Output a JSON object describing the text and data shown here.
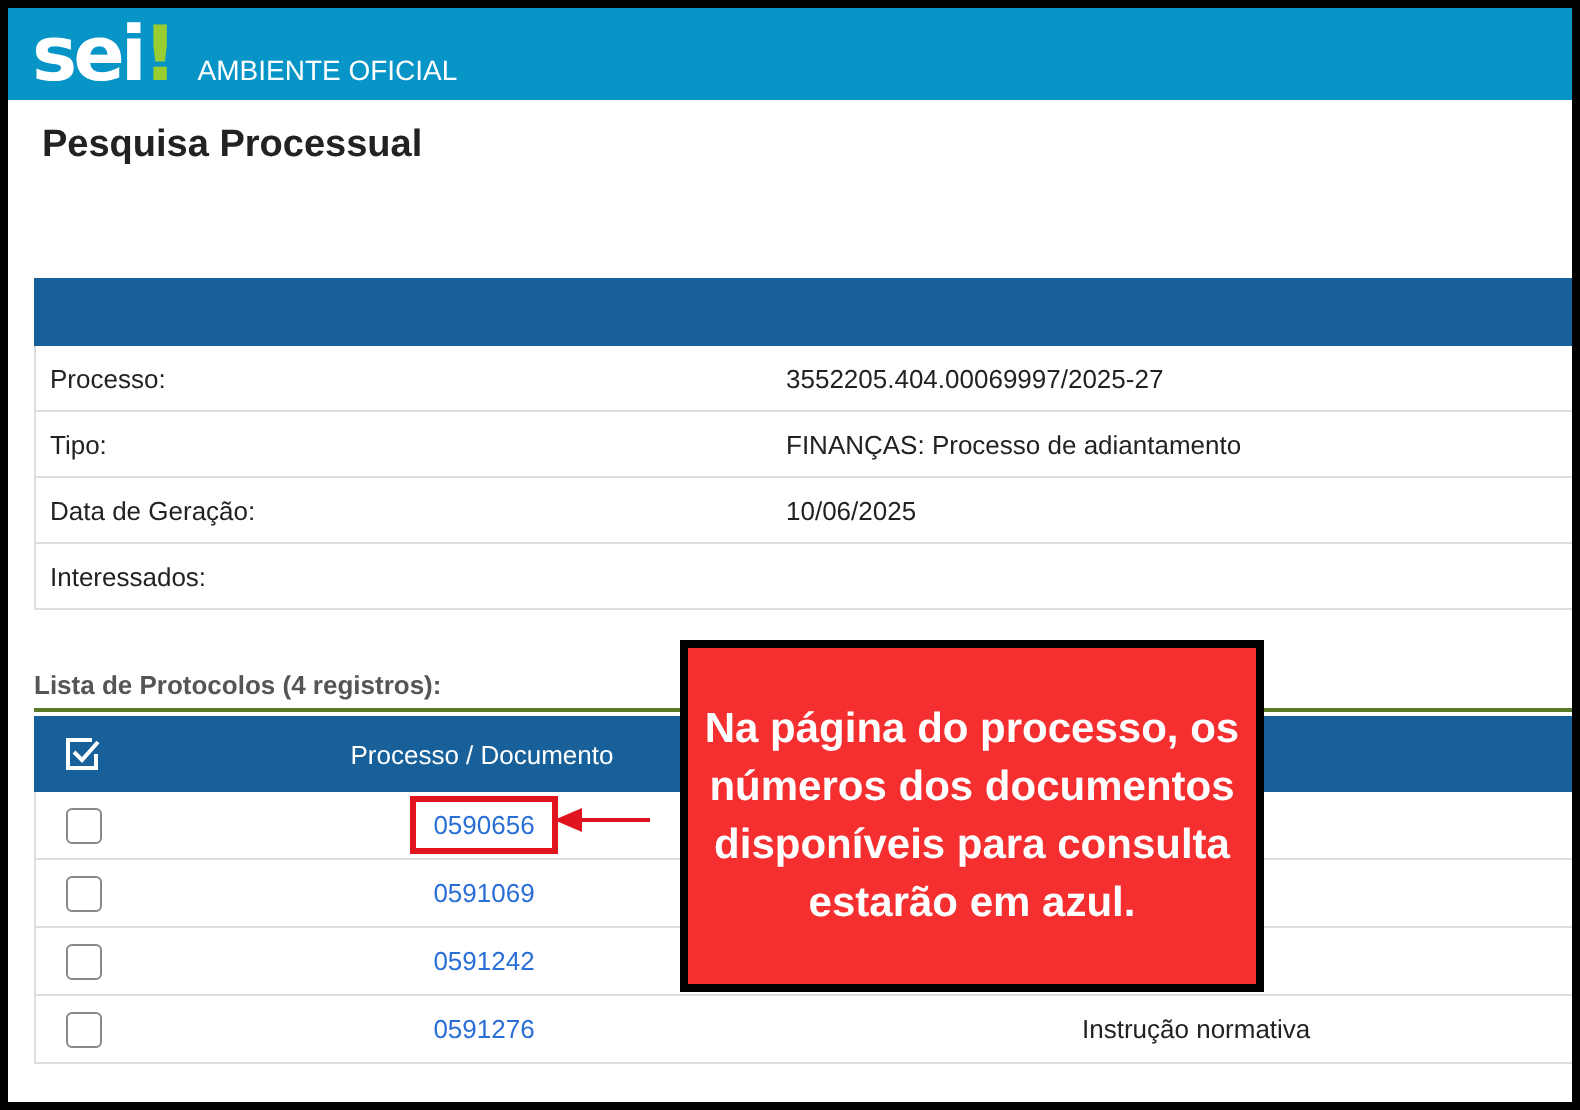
{
  "header": {
    "logo_text": "sei",
    "logo_mark": "!",
    "subtitle": "AMBIENTE OFICIAL"
  },
  "page_title": "Pesquisa Processual",
  "process_info": [
    {
      "label": "Processo:",
      "value": "3552205.404.00069997/2025-27"
    },
    {
      "label": "Tipo:",
      "value": "FINANÇAS: Processo de adiantamento"
    },
    {
      "label": "Data de Geração:",
      "value": "10/06/2025"
    },
    {
      "label": "Interessados:"
    }
  ],
  "protocol_list": {
    "title": "Lista de Protocolos (4 registros):",
    "columns": [
      "Processo / Documento"
    ],
    "rows": [
      {
        "checked": false,
        "number": "0590656",
        "highlighted": true
      },
      {
        "checked": false,
        "number": "0591069",
        "highlighted": false
      },
      {
        "checked": false,
        "number": "0591242",
        "highlighted": false
      },
      {
        "checked": false,
        "number": "0591276",
        "highlighted": false,
        "type": "Instrução normativa"
      }
    ]
  },
  "callout": {
    "text": "Na página do processo, os números dos documentos disponíveis para consulta estarão em azul."
  }
}
